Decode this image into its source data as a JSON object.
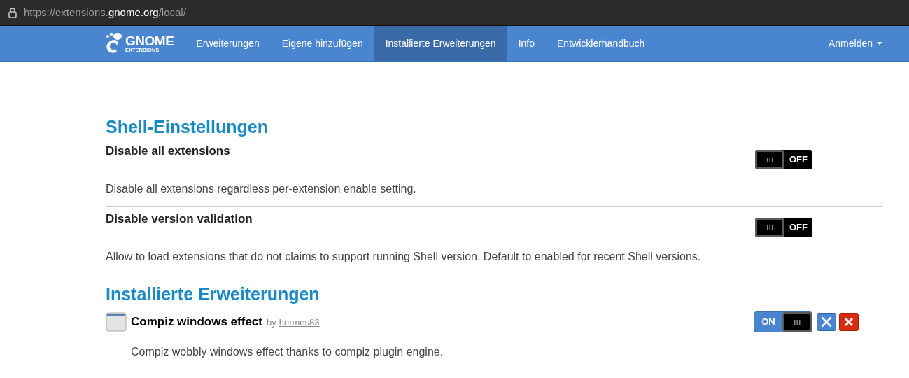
{
  "address_bar": {
    "url_scheme": "https://extensions.",
    "url_domain": "gnome.org",
    "url_path": "/local/"
  },
  "navbar": {
    "logo": {
      "title": "GNOME",
      "subtitle": "EXTENSIONS"
    },
    "items": [
      {
        "label": "Erweiterungen",
        "selected": false
      },
      {
        "label": "Eigene hinzufügen",
        "selected": false
      },
      {
        "label": "Installierte Erweiterungen",
        "selected": true
      },
      {
        "label": "Info",
        "selected": false
      },
      {
        "label": "Entwicklerhandbuch",
        "selected": false
      }
    ],
    "login": "Anmelden"
  },
  "shell_settings": {
    "heading": "Shell-Einstellungen",
    "settings": [
      {
        "title": "Disable all extensions",
        "description": "Disable all extensions regardless per-extension enable setting.",
        "toggle": {
          "on": false,
          "label": "OFF"
        }
      },
      {
        "title": "Disable version validation",
        "description": "Allow to load extensions that do not claims to support running Shell version. Default to enabled for recent Shell versions.",
        "toggle": {
          "on": false,
          "label": "OFF"
        }
      }
    ]
  },
  "installed": {
    "heading": "Installierte Erweiterungen",
    "extensions": [
      {
        "name": "Compiz windows effect",
        "by": "by",
        "author": "hermes83",
        "description": "Compiz wobbly windows effect thanks to compiz plugin engine.",
        "toggle": {
          "on": true,
          "label": "ON"
        }
      }
    ]
  }
}
